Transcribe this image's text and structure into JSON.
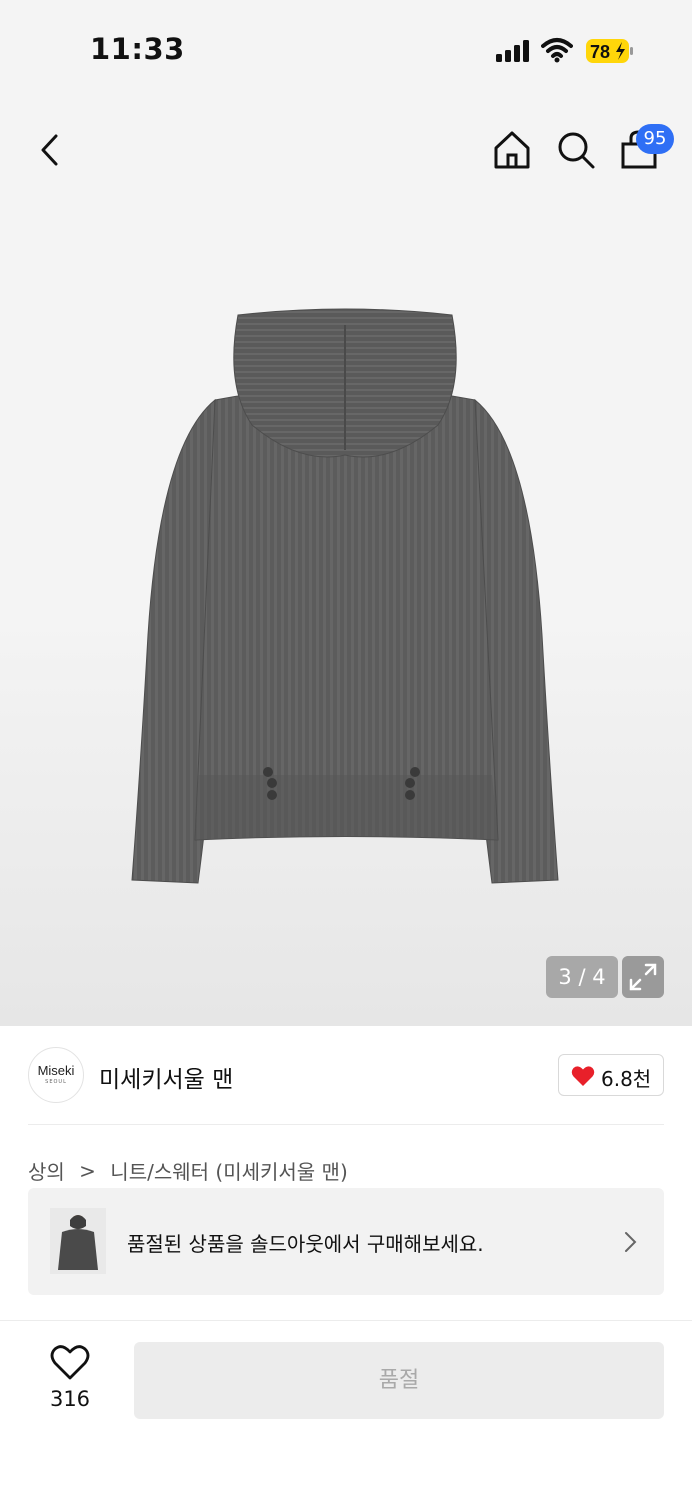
{
  "status_bar": {
    "time": "11:33",
    "battery": "78"
  },
  "nav": {
    "cart_badge": "95"
  },
  "gallery": {
    "counter": "3 / 4"
  },
  "brand": {
    "logo_line1": "Miseki",
    "logo_line2": "SEOUL",
    "name": "미세키서울 맨",
    "likes": "6.8천"
  },
  "breadcrumb": {
    "category": "상의",
    "separator": ">",
    "subcategory": "니트/스웨터 (미세키서울 맨)"
  },
  "soldout_banner": {
    "text": "품절된 상품을 솔드아웃에서 구매해보세요."
  },
  "bottom_bar": {
    "wish_count": "316",
    "action_label": "품절"
  },
  "colors": {
    "accent_blue": "#2f6ff5",
    "heart_red": "#e8202a",
    "battery_yellow": "#ffd60a"
  },
  "icons": [
    "back-icon",
    "home-icon",
    "search-icon",
    "bag-icon",
    "expand-icon",
    "heart-icon",
    "chevron-right-icon",
    "star-icon"
  ]
}
